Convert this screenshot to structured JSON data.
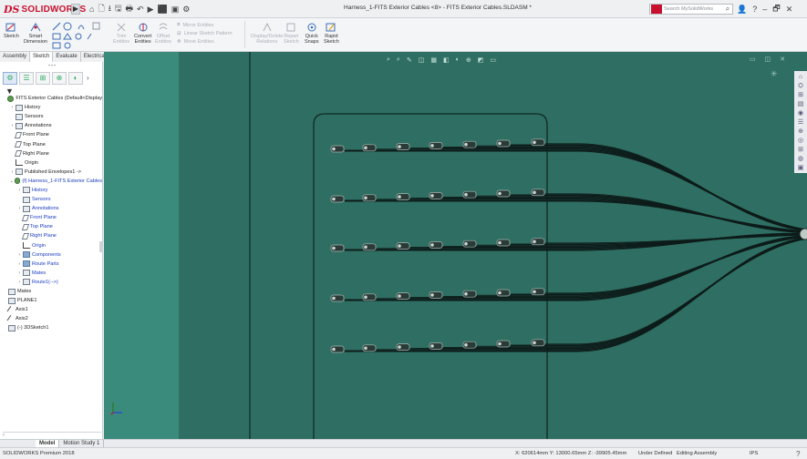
{
  "titlebar": {
    "logo_mark": "DS",
    "logo_text": "SOLIDWORKS",
    "logo_arrow": "▶",
    "window_title": "Harness_1-FITS Exterior Cables <8> - FITS Exterior Cables.SLDASM *",
    "search_placeholder": "Search MySolidWorks",
    "quick_access": [
      "⌂",
      "🗋",
      "⭳",
      "🖫",
      "🖶",
      "↶",
      "▶",
      "⬛",
      "▣",
      "⚙"
    ],
    "right_icons": [
      "?",
      "–",
      "🗗",
      "✕"
    ],
    "user_icon": "👤"
  },
  "ribbon": {
    "sketch": "Sketch",
    "smart_dimension": [
      "Smart",
      "Dimension"
    ],
    "trim": [
      "Trim",
      "Entities"
    ],
    "convert": [
      "Convert",
      "Entities"
    ],
    "offset": [
      "Offset",
      "Entities"
    ],
    "mirror": "Mirror Entities",
    "linear_pattern": "Linear Sketch Pattern",
    "move": "Move Entities",
    "display_delete": [
      "Display/Delete",
      "Relations"
    ],
    "repair": [
      "Repair",
      "Sketch"
    ],
    "quick_snaps": [
      "Quick",
      "Snaps"
    ],
    "rapid_sketch": [
      "Rapid",
      "Sketch"
    ]
  },
  "command_tabs": [
    "Assembly",
    "Sketch",
    "Evaluate",
    "Electrical"
  ],
  "feature_manager": {
    "tabs": [
      "⚙",
      "☰",
      "⊞",
      "⊕",
      "◐"
    ],
    "more": "›",
    "filter_icon": "▼",
    "tree": [
      {
        "label": "FITS Exterior Cables  (Default<Display",
        "level": 0,
        "toggle": "",
        "icon": "asm"
      },
      {
        "label": "History",
        "level": 1,
        "toggle": "›",
        "icon": "box"
      },
      {
        "label": "Sensors",
        "level": 1,
        "toggle": "",
        "icon": "box"
      },
      {
        "label": "Annotations",
        "level": 1,
        "toggle": "›",
        "icon": "box"
      },
      {
        "label": "Front Plane",
        "level": 1,
        "toggle": "",
        "icon": "plane"
      },
      {
        "label": "Top Plane",
        "level": 1,
        "toggle": "",
        "icon": "plane"
      },
      {
        "label": "Right Plane",
        "level": 1,
        "toggle": "",
        "icon": "plane"
      },
      {
        "label": "Origin",
        "level": 1,
        "toggle": "",
        "icon": "origin"
      },
      {
        "label": "Published Envelopes1 ->",
        "level": 1,
        "toggle": "›",
        "icon": "box"
      },
      {
        "label": "(f) Harness_1-FITS Exterior Cables",
        "level": 1,
        "toggle": "⌄",
        "icon": "asm",
        "style": "selected"
      },
      {
        "label": "History",
        "level": 2,
        "toggle": "›",
        "icon": "box",
        "style": "sub"
      },
      {
        "label": "Sensors",
        "level": 2,
        "toggle": "",
        "icon": "box",
        "style": "sub"
      },
      {
        "label": "Annotations",
        "level": 2,
        "toggle": "›",
        "icon": "box",
        "style": "sub"
      },
      {
        "label": "Front Plane",
        "level": 2,
        "toggle": "",
        "icon": "plane",
        "style": "sub"
      },
      {
        "label": "Top Plane",
        "level": 2,
        "toggle": "",
        "icon": "plane",
        "style": "sub"
      },
      {
        "label": "Right Plane",
        "level": 2,
        "toggle": "",
        "icon": "plane",
        "style": "sub"
      },
      {
        "label": "Origin",
        "level": 2,
        "toggle": "",
        "icon": "origin",
        "style": "sub"
      },
      {
        "label": "Components",
        "level": 2,
        "toggle": "›",
        "icon": "folder",
        "style": "sub"
      },
      {
        "label": "Route Parts",
        "level": 2,
        "toggle": "›",
        "icon": "folder",
        "style": "sub"
      },
      {
        "label": "Mates",
        "level": 2,
        "toggle": "›",
        "icon": "box",
        "style": "sub"
      },
      {
        "label": "Route1(-->)",
        "level": 2,
        "toggle": "›",
        "icon": "box",
        "style": "sub"
      },
      {
        "label": "Mates",
        "level": 0,
        "toggle": "",
        "icon": "box"
      },
      {
        "label": "PLANE1",
        "level": 0,
        "toggle": "",
        "icon": "box"
      },
      {
        "label": "Axis1",
        "level": 0,
        "toggle": "",
        "icon": "axis"
      },
      {
        "label": "Axis2",
        "level": 0,
        "toggle": "",
        "icon": "axis"
      },
      {
        "label": "(-) 3DSketch1",
        "level": 0,
        "toggle": "",
        "icon": "box"
      }
    ]
  },
  "viewport": {
    "hud_icons": [
      "⌕",
      "⌕",
      "✎",
      "◫",
      "▦",
      "◧",
      "◐",
      "⊕",
      "◩",
      "▭"
    ],
    "topright": [
      "▭",
      "◫",
      "✕"
    ],
    "task_pane": [
      "⌂",
      "⛭",
      "⊞",
      "▤",
      "◉",
      "☰",
      "⊕",
      "◎",
      "⊞",
      "◍",
      "▣"
    ]
  },
  "bottom_tabs": [
    "",
    "Model",
    "Motion Study 1"
  ],
  "status": {
    "left": "SOLIDWORKS Premium 2018",
    "coords": "X: 620614mm Y: 13000.65mm Z: -39905.45mm",
    "definition": "Under Defined",
    "editing": "Editing Assembly",
    "units": "IPS",
    "help_icon": "?"
  },
  "colors": {
    "viewport_bg": "#2f6e62",
    "viewport_left": "#3a8b7c",
    "brand_red": "#c8102e",
    "cable": "#0d1c1a"
  }
}
